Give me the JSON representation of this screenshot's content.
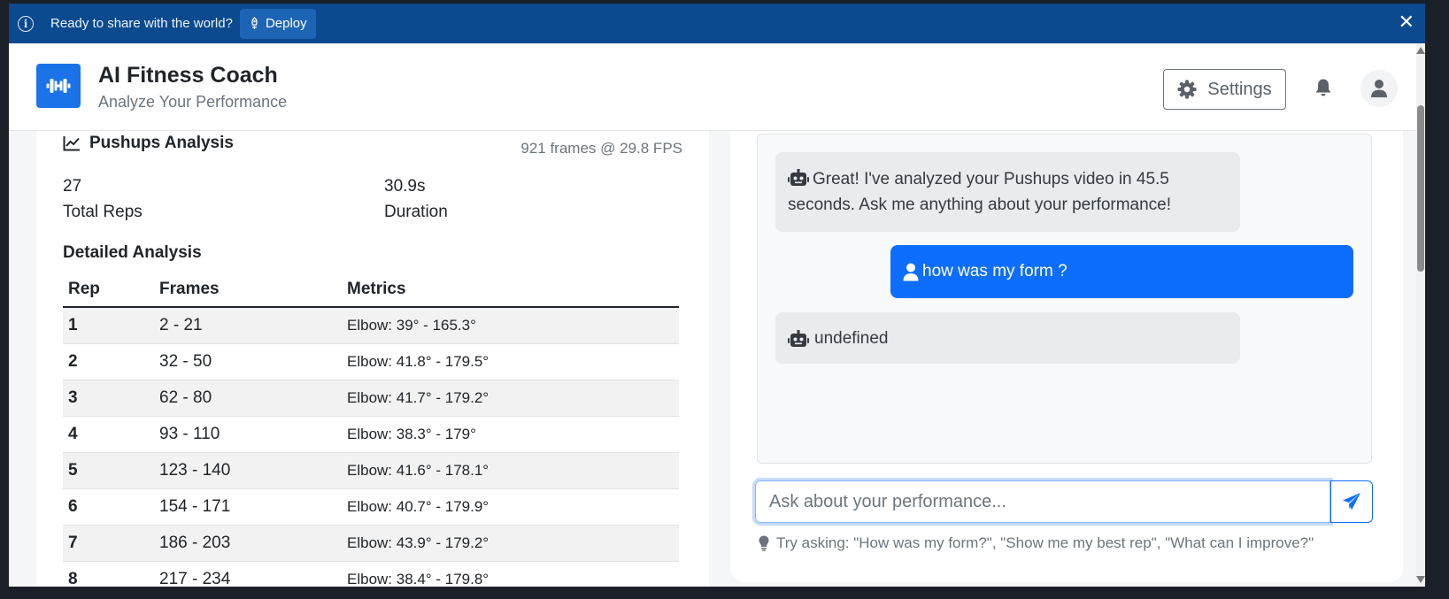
{
  "banner": {
    "text": "Ready to share with the world?",
    "deploy_label": "Deploy",
    "close_glyph": "✕",
    "bg_color": "#0b4a8f"
  },
  "header": {
    "title": "AI Fitness Coach",
    "subtitle": "Analyze Your Performance",
    "settings_label": "Settings",
    "accent": "#1a73e8"
  },
  "analysis": {
    "title": "Pushups Analysis",
    "frames_info": "921 frames @ 29.8 FPS",
    "stats": [
      {
        "value": "27",
        "label": "Total Reps"
      },
      {
        "value": "30.9s",
        "label": "Duration"
      }
    ],
    "detail_heading": "Detailed Analysis",
    "table": {
      "headers": [
        "Rep",
        "Frames",
        "Metrics"
      ],
      "rows": [
        [
          "1",
          "2 - 21",
          "Elbow: 39° - 165.3°"
        ],
        [
          "2",
          "32 - 50",
          "Elbow: 41.8° - 179.5°"
        ],
        [
          "3",
          "62 - 80",
          "Elbow: 41.7° - 179.2°"
        ],
        [
          "4",
          "93 - 110",
          "Elbow: 38.3° - 179°"
        ],
        [
          "5",
          "123 - 140",
          "Elbow: 41.6° - 178.1°"
        ],
        [
          "6",
          "154 - 171",
          "Elbow: 40.7° - 179.9°"
        ],
        [
          "7",
          "186 - 203",
          "Elbow: 43.9° - 179.2°"
        ],
        [
          "8",
          "217 - 234",
          "Elbow: 38.4° - 179.8°"
        ]
      ]
    }
  },
  "chat": {
    "messages": [
      {
        "role": "bot",
        "text": "Great! I've analyzed your Pushups video in 45.5 seconds. Ask me anything about your performance!"
      },
      {
        "role": "user",
        "text": "how was my form ?"
      },
      {
        "role": "bot",
        "text": "undefined"
      }
    ],
    "input_placeholder": "Ask about your performance...",
    "hint": "Try asking: \"How was my form?\", \"Show me my best rep\", \"What can I improve?\"",
    "user_bubble_color": "#0d6efd"
  }
}
